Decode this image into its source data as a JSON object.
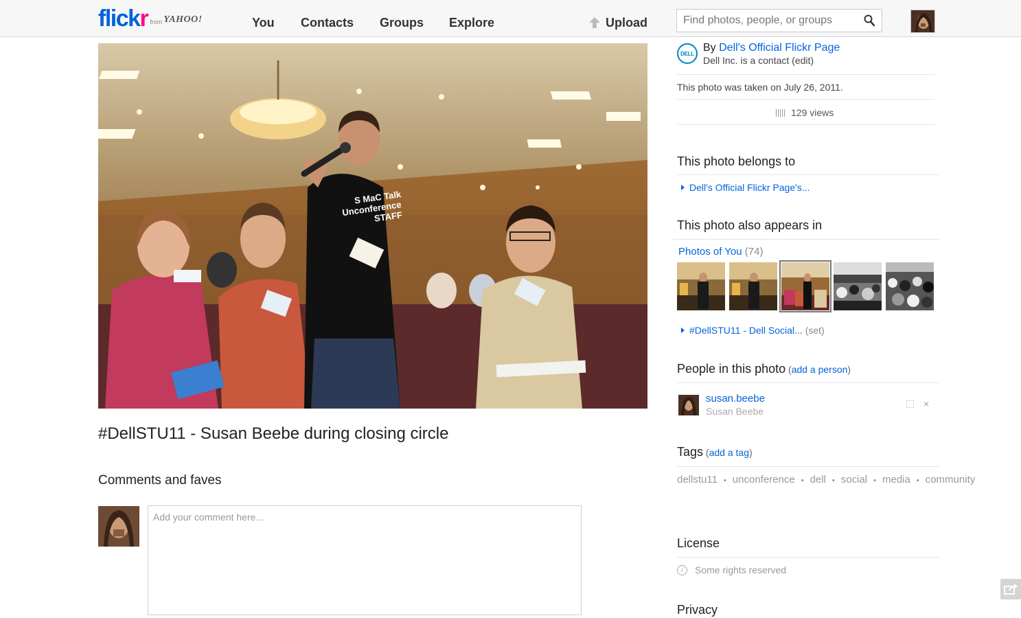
{
  "header": {
    "logo_flickr_a": "flick",
    "logo_flickr_b": "r",
    "logo_from": "from",
    "logo_yahoo": "YAHOO!",
    "nav": {
      "you": "You",
      "contacts": "Contacts",
      "groups": "Groups",
      "explore": "Explore"
    },
    "upload": "Upload",
    "search_placeholder": "Find photos, people, or groups"
  },
  "photo": {
    "title": "#DellSTU11 - Susan Beebe during closing circle"
  },
  "comments": {
    "heading": "Comments and faves",
    "placeholder": "Add your comment here..."
  },
  "sidebar": {
    "owner_logo_text": "DELL",
    "owner_by": "By ",
    "owner_name": "Dell's Official Flickr Page",
    "owner_sub": "Dell Inc. is a contact (edit)",
    "taken": "This photo was taken on July 26, 2011.",
    "views": "129 views",
    "belongs_heading": "This photo belongs to",
    "belongs_link": "Dell's Official Flickr Page's...",
    "appears_heading": "This photo also appears in",
    "pool_name": "Photos of You",
    "pool_count": " (74)",
    "set_link": "#DellSTU11 - Dell Social...",
    "set_label": "(set)",
    "people_heading": "People in this photo",
    "people_add_open": " (",
    "people_add": "add a person",
    "people_add_close": ")",
    "person_name": "susan.beebe",
    "person_real": "Susan Beebe",
    "person_remove": "×",
    "tags_heading": "Tags",
    "tags_add_open": " (",
    "tags_add": "add a tag",
    "tags_add_close": ")",
    "tags": [
      "dellstu11",
      "unconference",
      "dell",
      "social",
      "media",
      "community"
    ],
    "tag_separator": "•",
    "license_heading": "License",
    "license_text": "Some rights reserved",
    "license_icon": "i",
    "privacy_heading": "Privacy"
  }
}
